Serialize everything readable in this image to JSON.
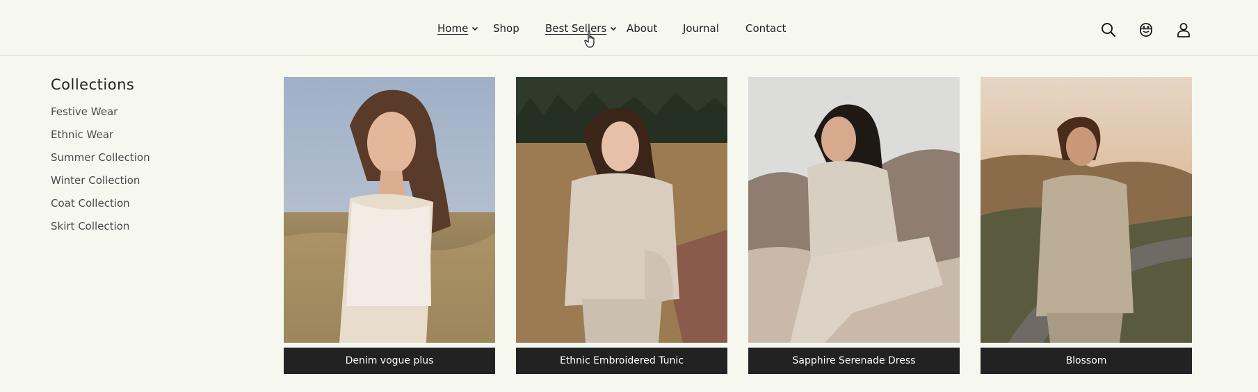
{
  "nav": {
    "items": [
      {
        "label": "Home",
        "dropdown": true,
        "underlined": true
      },
      {
        "label": "Shop",
        "dropdown": false,
        "underlined": false
      },
      {
        "label": "Best Sellers",
        "dropdown": true,
        "underlined": true
      },
      {
        "label": "About",
        "dropdown": false,
        "underlined": false
      },
      {
        "label": "Journal",
        "dropdown": false,
        "underlined": false
      },
      {
        "label": "Contact",
        "dropdown": false,
        "underlined": false
      }
    ]
  },
  "header_icons": [
    "search-icon",
    "basket-icon",
    "user-icon"
  ],
  "sidebar": {
    "title": "Collections",
    "items": [
      "Festive Wear",
      "Ethnic Wear",
      "Summer Collection",
      "Winter Collection",
      "Coat Collection",
      "Skirt Collection"
    ]
  },
  "products": [
    {
      "name": "Denim vogue plus"
    },
    {
      "name": "Ethnic Embroidered Tunic"
    },
    {
      "name": "Sapphire Serenade Dress"
    },
    {
      "name": "Blossom"
    }
  ],
  "colors": {
    "background": "#f6f8f0",
    "button": "#222222",
    "button_text": "#ffffff"
  }
}
